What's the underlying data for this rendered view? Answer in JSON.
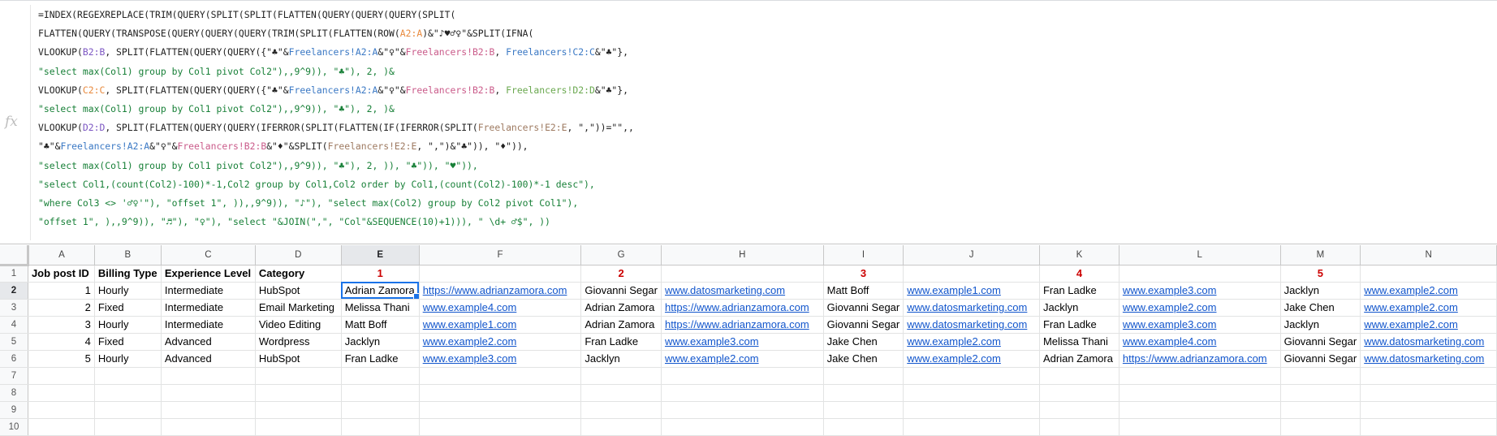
{
  "formula_bar": {
    "fx_label": "fx",
    "lines": [
      [
        {
          "t": "=INDEX(REGEXREPLACE(TRIM(QUERY(SPLIT(SPLIT(FLATTEN(QUERY(QUERY(QUERY(SPLIT(",
          "c": ""
        }
      ],
      [
        {
          "t": "FLATTEN(QUERY(TRANSPOSE(QUERY(QUERY(QUERY(TRIM(SPLIT(FLATTEN(ROW(",
          "c": ""
        },
        {
          "t": "A2:A",
          "c": "c-r2"
        },
        {
          "t": ")&\"♪♥♂♀\"&SPLIT(IFNA(",
          "c": ""
        }
      ],
      [
        {
          "t": "VLOOKUP(",
          "c": ""
        },
        {
          "t": "B2:B",
          "c": "c-r1"
        },
        {
          "t": ", SPLIT(FLATTEN(QUERY(QUERY({\"♣\"&",
          "c": ""
        },
        {
          "t": "Freelancers!A2:A",
          "c": "c-r3"
        },
        {
          "t": "&\"♀\"&",
          "c": ""
        },
        {
          "t": "Freelancers!B2:B",
          "c": "c-r4"
        },
        {
          "t": ", ",
          "c": ""
        },
        {
          "t": "Freelancers!C2:C",
          "c": "c-r3"
        },
        {
          "t": "&\"♣\"},",
          "c": ""
        }
      ],
      [
        {
          "t": "\"select max(Col1) group by Col1 pivot Col2\"),,9^9)), \"♣\"), 2, )&",
          "c": "c-str"
        }
      ],
      [
        {
          "t": "VLOOKUP(",
          "c": ""
        },
        {
          "t": "C2:C",
          "c": "c-r2"
        },
        {
          "t": ", SPLIT(FLATTEN(QUERY(QUERY({\"♣\"&",
          "c": ""
        },
        {
          "t": "Freelancers!A2:A",
          "c": "c-r3"
        },
        {
          "t": "&\"♀\"&",
          "c": ""
        },
        {
          "t": "Freelancers!B2:B",
          "c": "c-r4"
        },
        {
          "t": ", ",
          "c": ""
        },
        {
          "t": "Freelancers!D2:D",
          "c": "c-r5"
        },
        {
          "t": "&\"♣\"},",
          "c": ""
        }
      ],
      [
        {
          "t": "\"select max(Col1) group by Col1 pivot Col2\"),,9^9)), \"♣\"), 2, )&",
          "c": "c-str"
        }
      ],
      [
        {
          "t": "VLOOKUP(",
          "c": ""
        },
        {
          "t": "D2:D",
          "c": "c-r1"
        },
        {
          "t": ", SPLIT(FLATTEN(QUERY(QUERY(IFERROR(SPLIT(FLATTEN(IF(IFERROR(SPLIT(",
          "c": ""
        },
        {
          "t": "Freelancers!E2:E",
          "c": "c-r6"
        },
        {
          "t": ", \",\"))=\"\",,",
          "c": ""
        }
      ],
      [
        {
          "t": "\"♣\"&",
          "c": ""
        },
        {
          "t": "Freelancers!A2:A",
          "c": "c-r3"
        },
        {
          "t": "&\"♀\"&",
          "c": ""
        },
        {
          "t": "Freelancers!B2:B",
          "c": "c-r4"
        },
        {
          "t": "&\"♦\"&SPLIT(",
          "c": ""
        },
        {
          "t": "Freelancers!E2:E",
          "c": "c-r6"
        },
        {
          "t": ", \",\")&\"♣\")), \"♦\")),",
          "c": ""
        }
      ],
      [
        {
          "t": "\"select max(Col1) group by Col1 pivot Col2\"),,9^9)), \"♣\"), 2, )), \"♣\")), \"♥\")),",
          "c": "c-str"
        }
      ],
      [
        {
          "t": "\"select Col1,(count(Col2)-100)*-1,Col2 group by Col1,Col2 order by Col1,(count(Col2)-100)*-1 desc\"),",
          "c": "c-str"
        }
      ],
      [
        {
          "t": "\"where Col3 <> '♂♀'\"), \"offset 1\", )),,9^9)), \"♪\"), \"select max(Col2) group by Col2 pivot Col1\"),",
          "c": "c-str"
        }
      ],
      [
        {
          "t": "\"offset 1\", ),,9^9)), \"♬\"), \"♀\"), \"select \"&JOIN(\",\", \"Col\"&SEQUENCE(10)+1))), \" \\d+ ♂$\", ))",
          "c": "c-str"
        }
      ]
    ]
  },
  "columns": [
    "A",
    "B",
    "C",
    "D",
    "E",
    "F",
    "G",
    "H",
    "I",
    "J",
    "K",
    "L",
    "M",
    "N"
  ],
  "row_numbers": [
    "1",
    "2",
    "3",
    "4",
    "5",
    "6",
    "7",
    "8",
    "9",
    "10"
  ],
  "header_row": [
    "Job post ID",
    "Billing Type",
    "Experience Level",
    "Category",
    "1",
    "",
    "2",
    "",
    "3",
    "",
    "4",
    "",
    "5",
    ""
  ],
  "rows": [
    [
      "1",
      "Hourly",
      "Intermediate",
      "HubSpot",
      "Adrian Zamora",
      "https://www.adrianzamora.com",
      "Giovanni Segar",
      "www.datosmarketing.com",
      "Matt Boff",
      "www.example1.com",
      "Fran Ladke",
      "www.example3.com",
      "Jacklyn",
      "www.example2.com"
    ],
    [
      "2",
      "Fixed",
      "Intermediate",
      "Email Marketing",
      "Melissa Thani",
      "www.example4.com",
      "Adrian Zamora",
      "https://www.adrianzamora.com",
      "Giovanni Segar",
      "www.datosmarketing.com",
      "Jacklyn",
      "www.example2.com",
      "Jake Chen",
      "www.example2.com"
    ],
    [
      "3",
      "Hourly",
      "Intermediate",
      "Video Editing",
      "Matt Boff",
      "www.example1.com",
      "Adrian Zamora",
      "https://www.adrianzamora.com",
      "Giovanni Segar",
      "www.datosmarketing.com",
      "Fran Ladke",
      "www.example3.com",
      "Jacklyn",
      "www.example2.com"
    ],
    [
      "4",
      "Fixed",
      "Advanced",
      "Wordpress",
      "Jacklyn",
      "www.example2.com",
      "Fran Ladke",
      "www.example3.com",
      "Jake Chen",
      "www.example2.com",
      "Melissa Thani",
      "www.example4.com",
      "Giovanni Segar",
      "www.datosmarketing.com"
    ],
    [
      "5",
      "Hourly",
      "Advanced",
      "HubSpot",
      "Fran Ladke",
      "www.example3.com",
      "Jacklyn",
      "www.example2.com",
      "Jake Chen",
      "www.example2.com",
      "Adrian Zamora",
      "https://www.adrianzamora.com",
      "Giovanni Segar",
      "www.datosmarketing.com"
    ]
  ],
  "selected_cell": "E2",
  "colors": {
    "accent": "#1a73e8",
    "link": "#1155cc",
    "header_number": "#cc0000",
    "string": "#188038"
  }
}
